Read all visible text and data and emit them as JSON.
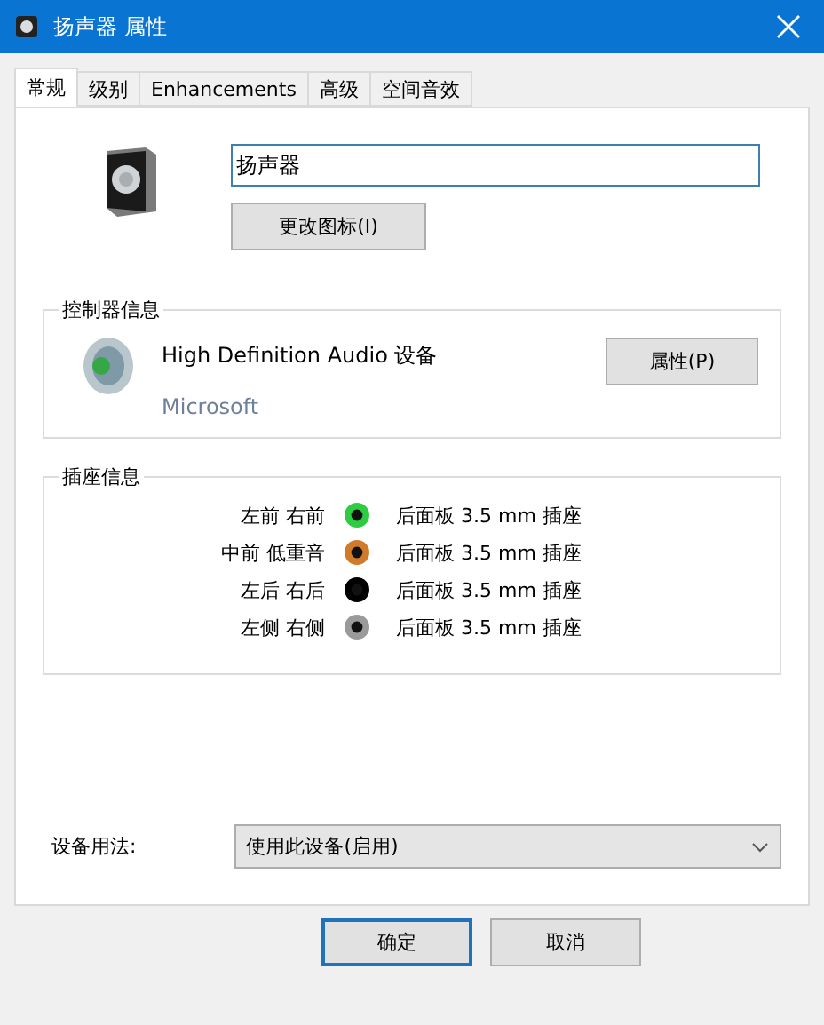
{
  "window": {
    "title": "扬声器 属性"
  },
  "tabs": [
    {
      "label": "常规",
      "selected": true
    },
    {
      "label": "级别",
      "selected": false
    },
    {
      "label": "Enhancements",
      "selected": false
    },
    {
      "label": "高级",
      "selected": false
    },
    {
      "label": "空间音效",
      "selected": false
    }
  ],
  "device_name": {
    "value": "扬声器"
  },
  "change_icon_button": "更改图标(I)",
  "controller": {
    "legend": "控制器信息",
    "name": "High Definition Audio 设备",
    "vendor": "Microsoft",
    "properties_button": "属性(P)"
  },
  "jacks": {
    "legend": "插座信息",
    "rows": [
      {
        "channels": "左前 右前",
        "color": "#2ecc40",
        "description": "后面板 3.5 mm 插座"
      },
      {
        "channels": "中前 低重音",
        "color": "#d07a2a",
        "description": "后面板 3.5 mm 插座"
      },
      {
        "channels": "左后 右后",
        "color": "#000000",
        "description": "后面板 3.5 mm 插座"
      },
      {
        "channels": "左侧 右侧",
        "color": "#9a9a9a",
        "description": "后面板 3.5 mm 插座"
      }
    ]
  },
  "usage": {
    "label": "设备用法:",
    "value": "使用此设备(启用)"
  },
  "buttons": [
    {
      "label": "确定",
      "default": true
    },
    {
      "label": "取消",
      "default": false
    }
  ]
}
